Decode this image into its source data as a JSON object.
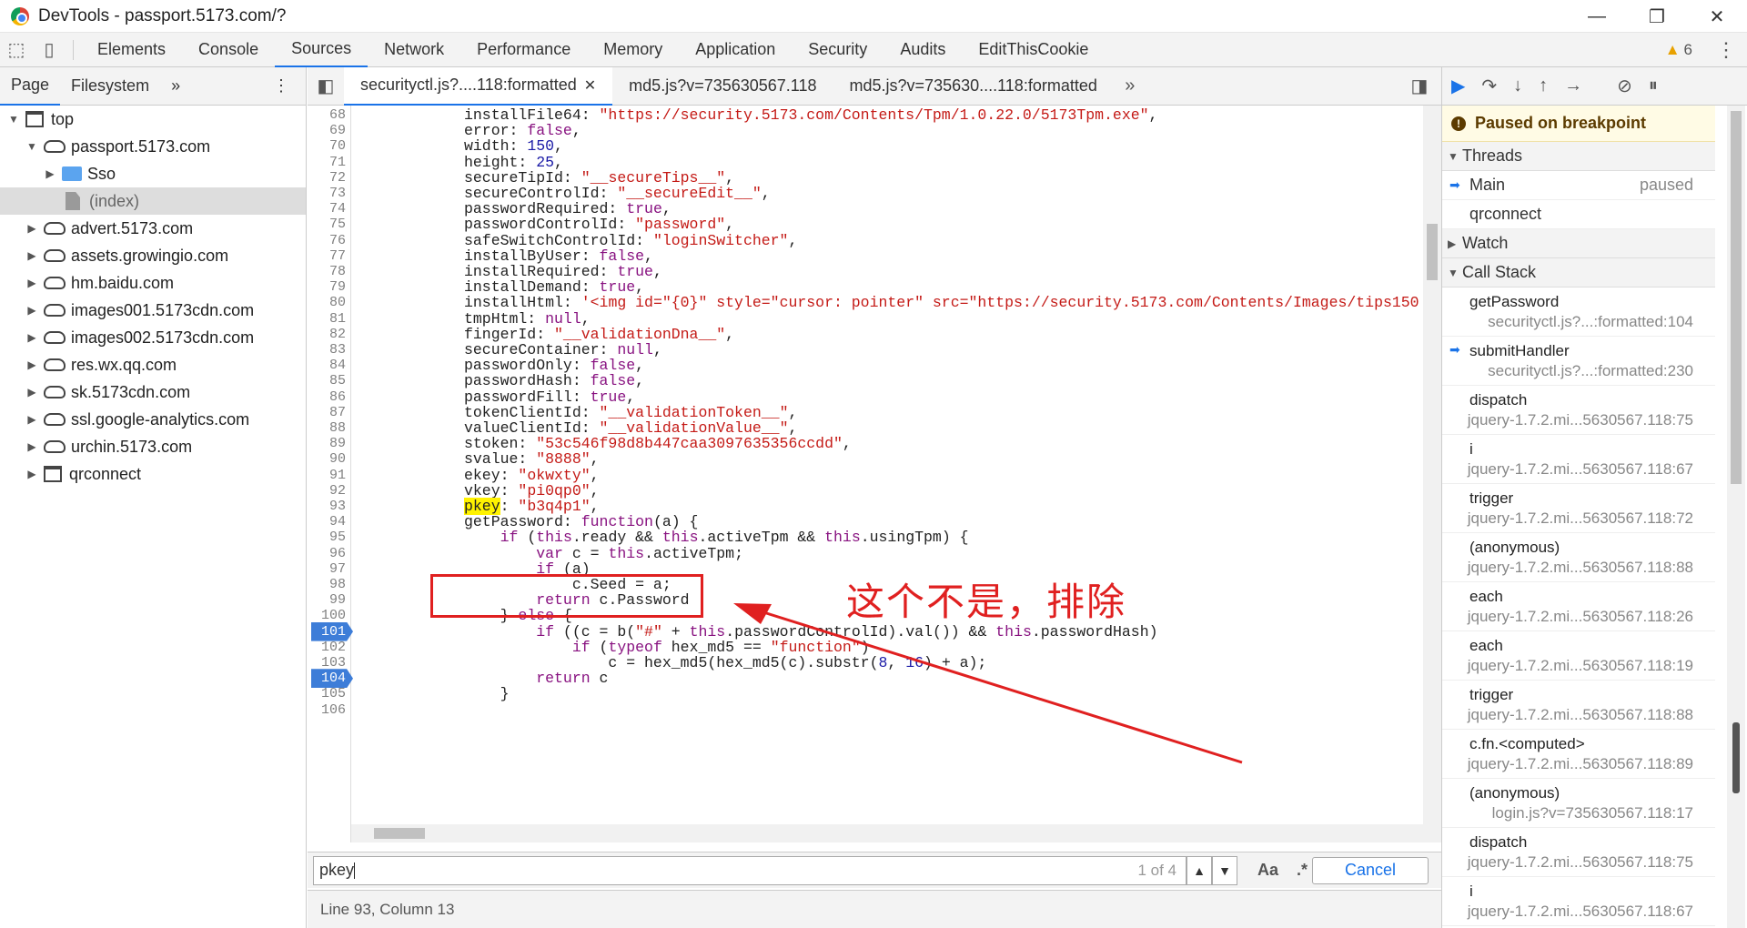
{
  "window": {
    "title": "DevTools - passport.5173.com/?",
    "controls": [
      "—",
      "❐",
      "✕"
    ]
  },
  "main_tabs": [
    "Elements",
    "Console",
    "Sources",
    "Network",
    "Performance",
    "Memory",
    "Application",
    "Security",
    "Audits",
    "EditThisCookie"
  ],
  "warning_count": "6",
  "navigator": {
    "tabs": [
      "Page",
      "Filesystem"
    ],
    "tree": [
      {
        "label": "top",
        "type": "frame",
        "level": 0,
        "open": true
      },
      {
        "label": "passport.5173.com",
        "type": "cloud",
        "level": 1,
        "open": true
      },
      {
        "label": "Sso",
        "type": "folder",
        "level": 2,
        "open": false
      },
      {
        "label": "(index)",
        "type": "file",
        "level": 2,
        "selected": true
      },
      {
        "label": "advert.5173.com",
        "type": "cloud",
        "level": 1
      },
      {
        "label": "assets.growingio.com",
        "type": "cloud",
        "level": 1
      },
      {
        "label": "hm.baidu.com",
        "type": "cloud",
        "level": 1
      },
      {
        "label": "images001.5173cdn.com",
        "type": "cloud",
        "level": 1
      },
      {
        "label": "images002.5173cdn.com",
        "type": "cloud",
        "level": 1
      },
      {
        "label": "res.wx.qq.com",
        "type": "cloud",
        "level": 1
      },
      {
        "label": "sk.5173cdn.com",
        "type": "cloud",
        "level": 1
      },
      {
        "label": "ssl.google-analytics.com",
        "type": "cloud",
        "level": 1
      },
      {
        "label": "urchin.5173.com",
        "type": "cloud",
        "level": 1
      },
      {
        "label": "qrconnect",
        "type": "frame",
        "level": 1
      }
    ]
  },
  "editor": {
    "tabs": [
      {
        "label": "securityctl.js?....118:formatted",
        "active": true,
        "close": "✕"
      },
      {
        "label": "md5.js?v=735630567.118",
        "active": false
      },
      {
        "label": "md5.js?v=735630....118:formatted",
        "active": false
      }
    ],
    "lines": [
      {
        "n": "68",
        "html": "installFile64: <span class='s'>\"https://security.5173.com/Contents/Tpm/1.0.22.0/5173Tpm.exe\"</span>,"
      },
      {
        "n": "69",
        "html": "error: <span class='k'>false</span>,"
      },
      {
        "n": "70",
        "html": "width: <span class='b'>150</span>,"
      },
      {
        "n": "71",
        "html": "height: <span class='b'>25</span>,"
      },
      {
        "n": "72",
        "html": "secureTipId: <span class='s'>\"__secureTips__\"</span>,"
      },
      {
        "n": "73",
        "html": "secureControlId: <span class='s'>\"__secureEdit__\"</span>,"
      },
      {
        "n": "74",
        "html": "passwordRequired: <span class='k'>true</span>,"
      },
      {
        "n": "75",
        "html": "passwordControlId: <span class='s'>\"password\"</span>,"
      },
      {
        "n": "76",
        "html": "safeSwitchControlId: <span class='s'>\"loginSwitcher\"</span>,"
      },
      {
        "n": "77",
        "html": "installByUser: <span class='k'>false</span>,"
      },
      {
        "n": "78",
        "html": "installRequired: <span class='k'>true</span>,"
      },
      {
        "n": "79",
        "html": "installDemand: <span class='k'>true</span>,"
      },
      {
        "n": "80",
        "html": "installHtml: <span class='s'>'&lt;img id=\"{0}\" style=\"cursor: pointer\" src=\"https://security.5173.com/Contents/Images/tips150</span>"
      },
      {
        "n": "81",
        "html": "tmpHtml: <span class='k'>null</span>,"
      },
      {
        "n": "82",
        "html": "fingerId: <span class='s'>\"__validationDna__\"</span>,"
      },
      {
        "n": "83",
        "html": "secureContainer: <span class='k'>null</span>,"
      },
      {
        "n": "84",
        "html": "passwordOnly: <span class='k'>false</span>,"
      },
      {
        "n": "85",
        "html": "passwordHash: <span class='k'>false</span>,"
      },
      {
        "n": "86",
        "html": "passwordFill: <span class='k'>true</span>,"
      },
      {
        "n": "87",
        "html": "tokenClientId: <span class='s'>\"__validationToken__\"</span>,"
      },
      {
        "n": "88",
        "html": "valueClientId: <span class='s'>\"__validationValue__\"</span>,"
      },
      {
        "n": "89",
        "html": "stoken: <span class='s'>\"53c546f98d8b447caa3097635356ccdd\"</span>,"
      },
      {
        "n": "90",
        "html": "svalue: <span class='s'>\"8888\"</span>,"
      },
      {
        "n": "91",
        "html": "ekey: <span class='s'>\"okwxty\"</span>,"
      },
      {
        "n": "92",
        "html": "vkey: <span class='s'>\"pi0qp0\"</span>,"
      },
      {
        "n": "93",
        "html": "<span class='hl'>pkey</span>: <span class='s'>\"b3q4p1\"</span>,"
      },
      {
        "n": "94",
        "html": "getPassword: <span class='k'>function</span>(a) {"
      },
      {
        "n": "95",
        "html": "    <span class='k'>if</span> (<span class='k'>this</span>.ready &amp;&amp; <span class='k'>this</span>.activeTpm &amp;&amp; <span class='k'>this</span>.usingTpm) {"
      },
      {
        "n": "96",
        "html": "        <span class='k'>var</span> c = <span class='k'>this</span>.activeTpm;"
      },
      {
        "n": "97",
        "html": "        <span class='k'>if</span> (a)"
      },
      {
        "n": "98",
        "html": "            c.Seed = a;"
      },
      {
        "n": "99",
        "html": "        <span class='k'>return</span> c.Password"
      },
      {
        "n": "100",
        "html": "    } <span class='k'>else</span> {"
      },
      {
        "n": "101",
        "bp": true,
        "html": "        <span class='k'>if</span> ((c = b(<span class='s'>\"#\"</span> + <span class='k'>this</span>.passwordControlId).val()) &amp;&amp; <span class='k'>this</span>.passwordHash)"
      },
      {
        "n": "102",
        "html": "            <span class='k'>if</span> (<span class='k'>typeof</span> hex_md5 == <span class='s'>\"function\"</span>)"
      },
      {
        "n": "103",
        "html": "                c = hex_md5(hex_md5(c).substr(<span class='b'>8</span>, <span class='b'>16</span>) + a);"
      },
      {
        "n": "104",
        "bp": true,
        "html": "        <span class='k'>return</span> c"
      },
      {
        "n": "105",
        "html": "    }"
      },
      {
        "n": "106",
        "html": ""
      }
    ]
  },
  "search": {
    "value": "pkey",
    "count": "1 of 4",
    "case_label": "Aa",
    "regex_label": ".*",
    "cancel_label": "Cancel"
  },
  "status": {
    "position": "Line 93, Column 13"
  },
  "debugger": {
    "paused_label": "Paused on breakpoint",
    "threads_label": "Threads",
    "threads": [
      {
        "name": "Main",
        "state": "paused",
        "current": true
      },
      {
        "name": "qrconnect",
        "state": ""
      }
    ],
    "watch_label": "Watch",
    "callstack_label": "Call Stack",
    "frames": [
      {
        "fn": "getPassword",
        "loc": "securityctl.js?...:formatted:104",
        "current": false
      },
      {
        "fn": "submitHandler",
        "loc": "securityctl.js?...:formatted:230",
        "current": true
      },
      {
        "fn": "dispatch",
        "loc": "jquery-1.7.2.mi...5630567.118:75"
      },
      {
        "fn": "i",
        "loc": "jquery-1.7.2.mi...5630567.118:67"
      },
      {
        "fn": "trigger",
        "loc": "jquery-1.7.2.mi...5630567.118:72"
      },
      {
        "fn": "(anonymous)",
        "loc": "jquery-1.7.2.mi...5630567.118:88"
      },
      {
        "fn": "each",
        "loc": "jquery-1.7.2.mi...5630567.118:26"
      },
      {
        "fn": "each",
        "loc": "jquery-1.7.2.mi...5630567.118:19"
      },
      {
        "fn": "trigger",
        "loc": "jquery-1.7.2.mi...5630567.118:88"
      },
      {
        "fn": "c.fn.<computed>",
        "loc": "jquery-1.7.2.mi...5630567.118:89"
      },
      {
        "fn": "(anonymous)",
        "loc": "login.js?v=735630567.118:17"
      },
      {
        "fn": "dispatch",
        "loc": "jquery-1.7.2.mi...5630567.118:75"
      },
      {
        "fn": "i",
        "loc": "jquery-1.7.2.mi...5630567.118:67"
      }
    ]
  },
  "annotation": {
    "text": "这个不是，排除",
    "color": "#e02020"
  }
}
